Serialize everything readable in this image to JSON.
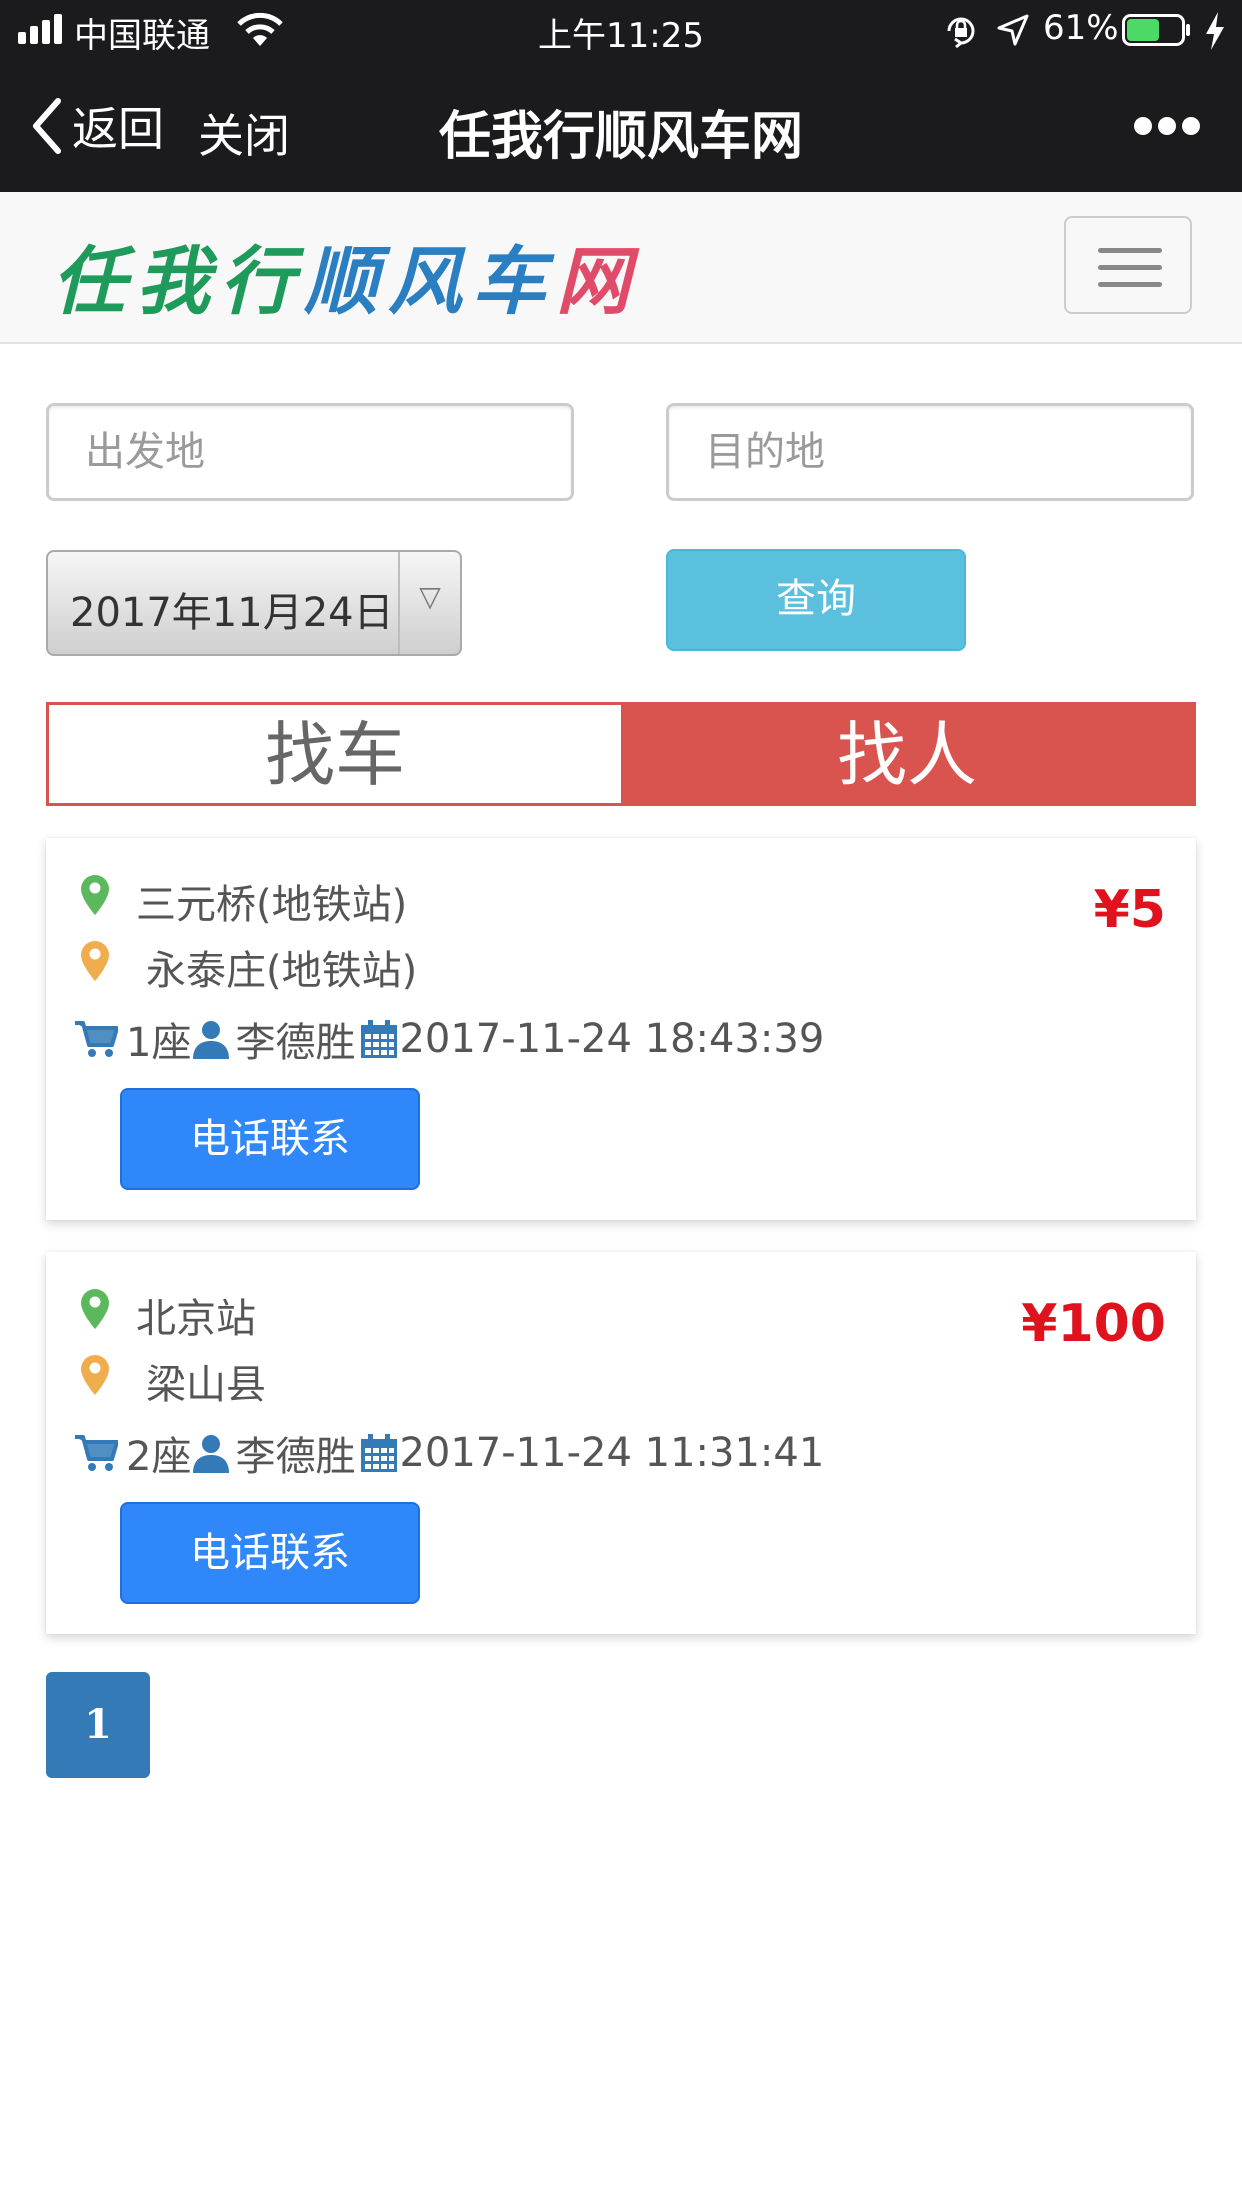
{
  "status_bar": {
    "carrier": "中国联通",
    "time": "上午11:25",
    "battery_percent": "61%",
    "battery_level": 0.61,
    "icons": [
      "signal-icon",
      "wifi-icon",
      "orientation-lock-icon",
      "location-icon",
      "battery-icon",
      "charging-icon"
    ]
  },
  "nav": {
    "back_label": "返回",
    "close_label": "关闭",
    "title": "任我行顺风车网",
    "more_icon": "more-dots-icon"
  },
  "header": {
    "logo_chars": [
      "任",
      "我",
      "行",
      "顺",
      "风",
      "车",
      "网"
    ],
    "logo_colors": [
      "#1e9a5b",
      "#1e9a5b",
      "#1e9a5b",
      "#2a7fc2",
      "#2a7fc2",
      "#2a7fc2",
      "#e04b6a"
    ],
    "menu_icon": "hamburger-menu-icon"
  },
  "search": {
    "from_placeholder": "出发地",
    "to_placeholder": "目的地",
    "date_value": "2017年11月24日",
    "date_arrow": "▽",
    "submit_label": "查询"
  },
  "tabs": {
    "find_car": "找车",
    "find_person": "找人",
    "active": "find_person",
    "active_color": "#d9534f"
  },
  "rides": [
    {
      "origin": "三元桥(地铁站)",
      "destination": "永泰庄(地铁站)",
      "price": "¥5",
      "seats": "1座",
      "name": "李德胜",
      "datetime": "2017-11-24 18:43:39",
      "call_label": "电话联系"
    },
    {
      "origin": "北京站",
      "destination": "梁山县",
      "price": "¥100",
      "seats": "2座",
      "name": "李德胜",
      "datetime": "2017-11-24 11:31:41",
      "call_label": "电话联系"
    }
  ],
  "pagination": {
    "current": "1"
  },
  "colors": {
    "bar_dark": "#1b1b1d",
    "primary_blue": "#2f87f9",
    "search_cyan": "#5bc0de",
    "price_red": "#e0121d",
    "pin_green": "#5cb85c",
    "pin_orange": "#f0ad4e",
    "meta_blue": "#337ab7",
    "page_blue": "#337ab7"
  }
}
